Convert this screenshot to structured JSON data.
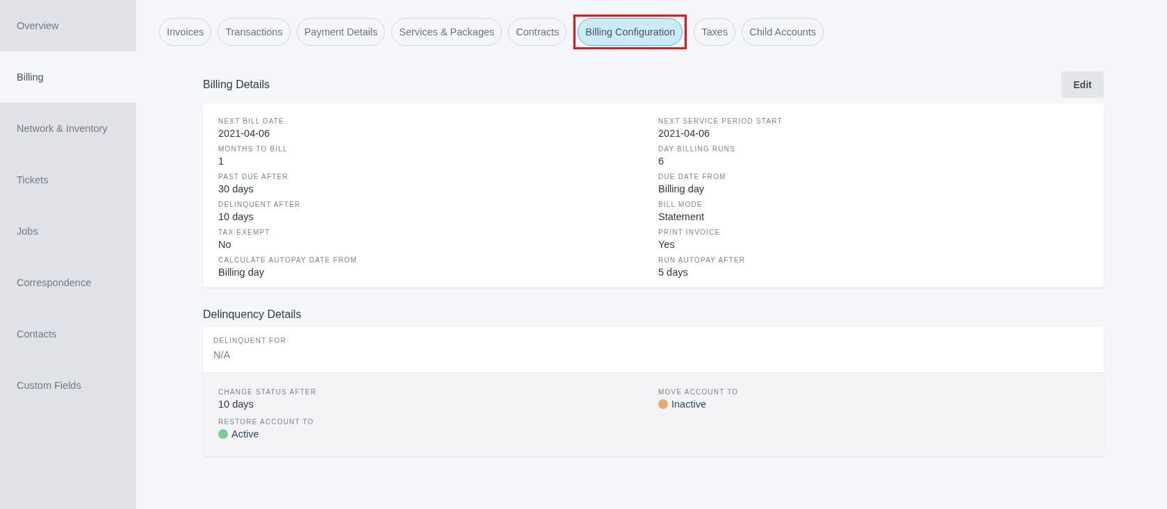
{
  "sidebar": {
    "items": [
      {
        "label": "Overview",
        "selected": false
      },
      {
        "label": "Billing",
        "selected": true
      },
      {
        "label": "Network & Inventory",
        "selected": false
      },
      {
        "label": "Tickets",
        "selected": false
      },
      {
        "label": "Jobs",
        "selected": false
      },
      {
        "label": "Correspondence",
        "selected": false
      },
      {
        "label": "Contacts",
        "selected": false
      },
      {
        "label": "Custom Fields",
        "selected": false
      }
    ]
  },
  "tabs": [
    {
      "label": "Invoices",
      "selected": false,
      "highlighted": false
    },
    {
      "label": "Transactions",
      "selected": false,
      "highlighted": false
    },
    {
      "label": "Payment Details",
      "selected": false,
      "highlighted": false
    },
    {
      "label": "Services & Packages",
      "selected": false,
      "highlighted": false
    },
    {
      "label": "Contracts",
      "selected": false,
      "highlighted": false
    },
    {
      "label": "Billing Configuration",
      "selected": true,
      "highlighted": true
    },
    {
      "label": "Taxes",
      "selected": false,
      "highlighted": false
    },
    {
      "label": "Child Accounts",
      "selected": false,
      "highlighted": false
    }
  ],
  "billing_details": {
    "title": "Billing Details",
    "edit_button": "Edit",
    "fields": [
      {
        "label": "NEXT BILL DATE",
        "value": "2021-04-06"
      },
      {
        "label": "NEXT SERVICE PERIOD START",
        "value": "2021-04-06"
      },
      {
        "label": "MONTHS TO BILL",
        "value": "1"
      },
      {
        "label": "DAY BILLING RUNS",
        "value": "6"
      },
      {
        "label": "PAST DUE AFTER",
        "value": "30 days"
      },
      {
        "label": "DUE DATE FROM",
        "value": "Billing day"
      },
      {
        "label": "DELINQUENT AFTER",
        "value": "10 days"
      },
      {
        "label": "BILL MODE",
        "value": "Statement"
      },
      {
        "label": "TAX EXEMPT",
        "value": "No"
      },
      {
        "label": "PRINT INVOICE",
        "value": "Yes"
      },
      {
        "label": "CALCULATE AUTOPAY DATE FROM",
        "value": "Billing day"
      },
      {
        "label": "RUN AUTOPAY AFTER",
        "value": "5 days"
      }
    ]
  },
  "delinquency_details": {
    "title": "Delinquency Details",
    "delinquent_for": {
      "label": "DELINQUENT FOR",
      "value": "N/A"
    },
    "rules": [
      {
        "label": "CHANGE STATUS AFTER",
        "value": "10 days"
      },
      {
        "label": "MOVE ACCOUNT TO",
        "value": "Inactive",
        "color": "#eaa96c"
      },
      {
        "label": "RESTORE ACCOUNT TO",
        "value": "Active",
        "color": "#7dcb9b"
      }
    ]
  }
}
